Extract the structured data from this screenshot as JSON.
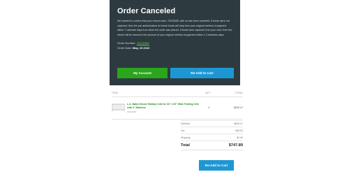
{
  "hero": {
    "title": "Order Canceled",
    "message": "We wanted to confirm that your recent order, 75225355, with us has been canceled. If funds were not captured, then the pre-authorization for those funds will drop from your original method of payment within 7 calendar days from when the order was placed. If funds were captured from your card, then the refund will be issued to the account of your original method of payment within 1-3 business days.",
    "order_number_label": "Order Number:",
    "order_number": "75225355",
    "order_date_label": "Order Date:",
    "order_date": "May, 23 2022",
    "my_account_label": "My Account",
    "readd_label": "Re-Add to Cart"
  },
  "items": {
    "headers": {
      "item": "ITEM",
      "qty": "QTY",
      "total": "TOTAL"
    },
    "rows": [
      {
        "name": "L.A. Baby Deluxe Holiday Crib for 34\" x 52\" Wide Folding Crib with 3\" Mattress",
        "sku": "INS72080",
        "qty": "4",
        "total": "$539.47",
        "image": "crib-product-image"
      }
    ]
  },
  "summary": {
    "subtotal_label": "Subtotal",
    "subtotal": "$539.47",
    "tax_label": "Tax",
    "tax": "$48.52",
    "shipping_label": "Shipping",
    "shipping": "$0.00",
    "total_label": "Total",
    "total": "$747.89"
  },
  "bottom": {
    "readd_label": "Re-Add to Cart"
  },
  "colors": {
    "hero_bg": "#2d3b40",
    "green": "#2aa51c",
    "blue": "#1d97d3",
    "link_green": "#6ccf3a"
  }
}
